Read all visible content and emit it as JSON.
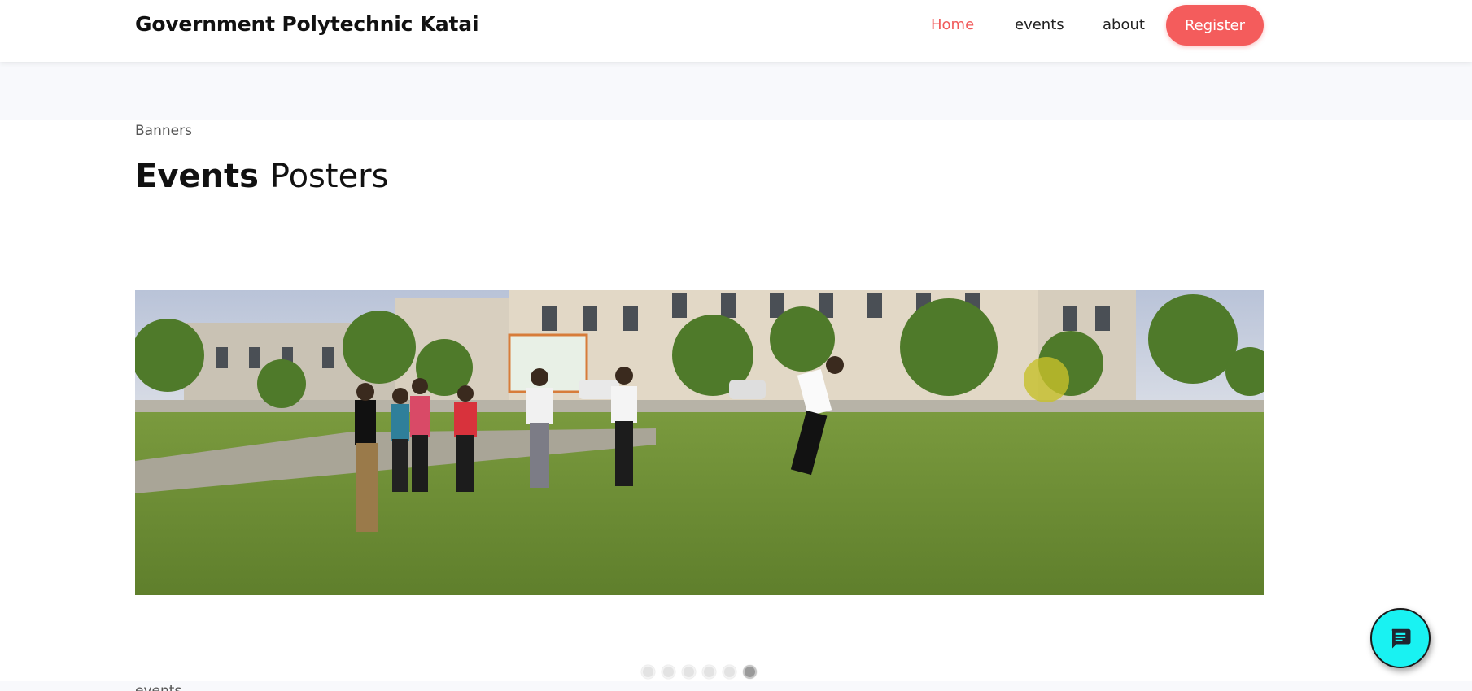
{
  "navbar": {
    "brand": "Government Polytechnic Katai",
    "links": [
      {
        "label": "Home",
        "active": true
      },
      {
        "label": "events",
        "active": false
      },
      {
        "label": "about",
        "active": false
      }
    ],
    "register_label": "Register"
  },
  "section": {
    "label": "Banners",
    "title_strong": "Events",
    "title_light": "Posters"
  },
  "carousel": {
    "slide_count": 6,
    "active_index": 5
  },
  "next_section": {
    "label": "events"
  },
  "chat": {
    "icon": "chat-icon"
  },
  "colors": {
    "accent": "#f45c5c",
    "chat_bg": "#19f2f2"
  }
}
